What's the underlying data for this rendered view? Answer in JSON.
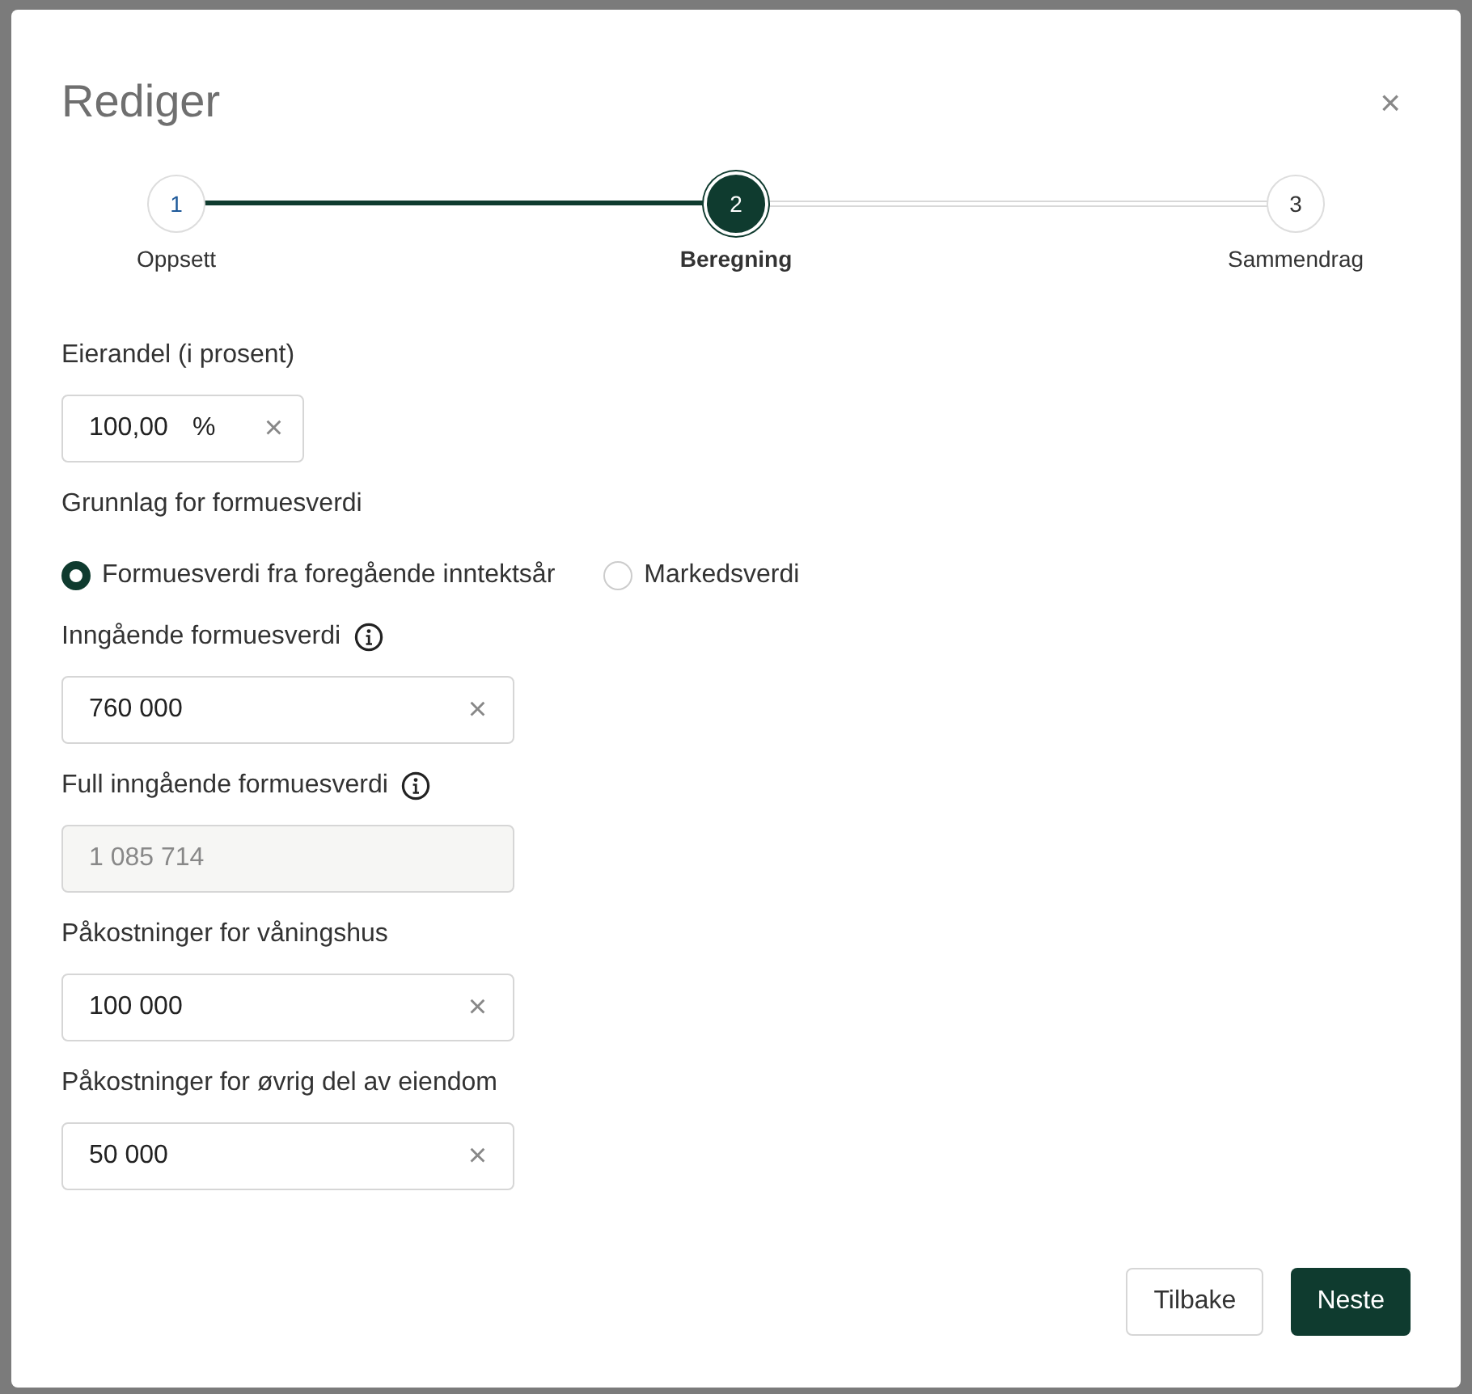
{
  "dialog": {
    "title": "Rediger",
    "close": "×"
  },
  "steps": [
    {
      "number": "1",
      "label": "Oppsett",
      "selected": false
    },
    {
      "number": "2",
      "label": "Beregning",
      "selected": true
    },
    {
      "number": "3",
      "label": "Sammendrag",
      "selected": false
    }
  ],
  "fields": [
    {
      "kind": "percent",
      "label": "Eierandel (i prosent)",
      "value": "100,00",
      "unit": "%",
      "clear": "×"
    },
    {
      "kind": "radio",
      "label": "Grunnlag for formuesverdi",
      "options": [
        {
          "label": "Formuesverdi fra foregående inntektsår",
          "selected": true
        },
        {
          "label": "Markedsverdi",
          "selected": false
        }
      ]
    },
    {
      "kind": "text",
      "label": "Inngående formuesverdi",
      "info": true,
      "value": "760 000",
      "clear": "×"
    },
    {
      "kind": "readonly",
      "label": "Full inngående formuesverdi",
      "info": true,
      "value": "1 085 714"
    },
    {
      "kind": "text",
      "label": "Påkostninger for våningshus",
      "info": false,
      "value": "100 000",
      "clear": "×"
    },
    {
      "kind": "text",
      "label": "Påkostninger for øvrig del av eiendom",
      "info": false,
      "value": "50 000",
      "clear": "×"
    }
  ],
  "buttons": [
    {
      "kind": "secondary",
      "label": "Tilbake"
    },
    {
      "kind": "primary",
      "label": "Neste"
    }
  ]
}
